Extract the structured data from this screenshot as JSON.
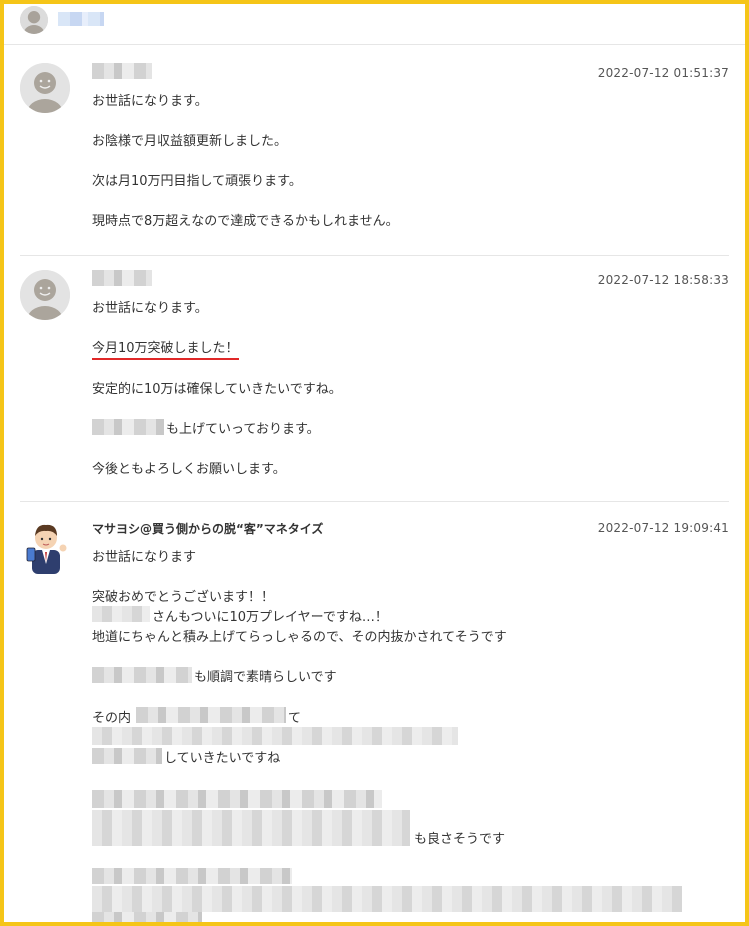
{
  "posts": [
    {
      "timestamp": "2022-07-12 01:51:37",
      "lines": [
        "お世話になります。",
        "お陰様で月収益額更新しました。",
        "次は月10万円目指して頑張ります。",
        "現時点で8万超えなので達成できるかもしれません。"
      ]
    },
    {
      "timestamp": "2022-07-12 18:58:33",
      "lines": [
        "お世話になります。",
        "今月10万突破しました！",
        "安定的に10万は確保していきたいですね。",
        "も上げていっております。",
        "今後ともよろしくお願いします。"
      ]
    },
    {
      "author": "マサヨシ@買う側からの脱“客”マネタイズ",
      "timestamp": "2022-07-12 19:09:41",
      "lines": [
        "お世話になります",
        "突破おめでとうございます！！",
        "さんもついに10万プレイヤーですね…！",
        "地道にちゃんと積み上げてらっしゃるので、その内抜かされてそうです",
        "も順調で素晴らしいです",
        "その内",
        "て",
        "していきたいですね",
        "も良さそうです"
      ]
    }
  ],
  "icons": {
    "user_avatar": "default-user-avatar-icon",
    "author_avatar": "businessman-mascot-icon"
  },
  "colors": {
    "frame_border": "#f5c518",
    "highlight_underline": "#e02828"
  }
}
